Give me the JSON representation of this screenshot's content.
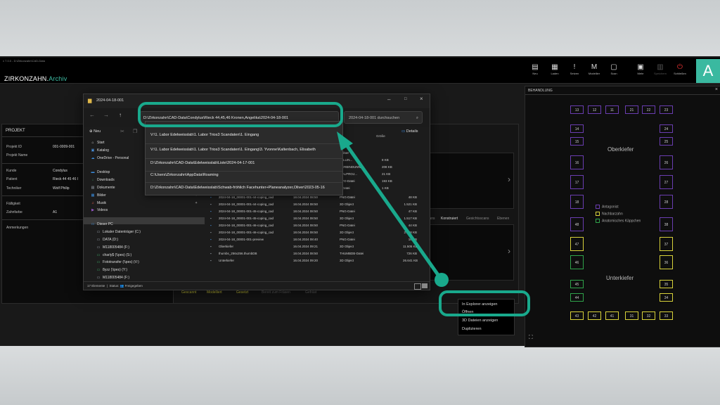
{
  "app": {
    "window_caption": "v 7.0.0 - D:\\Zirkonzahn\\CAD-Data",
    "logo_main": "ZIRKONZAHN.",
    "logo_accent": "Archiv",
    "badge": "A",
    "toolbar": [
      {
        "label": "Neu",
        "icon": "file-icon",
        "glyph": "▤"
      },
      {
        "label": "Laden",
        "icon": "folder-icon",
        "glyph": "▦"
      },
      {
        "label": "Setzen",
        "icon": "exclamation-icon",
        "glyph": "!"
      },
      {
        "label": "Modellier",
        "icon": "m-icon",
        "glyph": "M"
      },
      {
        "label": "Scan",
        "icon": "scan-icon",
        "glyph": "▢"
      },
      {
        "label": "Mehr",
        "icon": "more-icon",
        "glyph": "▣"
      },
      {
        "label": "Speichern",
        "icon": "save-icon",
        "glyph": "▥"
      },
      {
        "label": "Schließen",
        "icon": "close-app-icon",
        "glyph": "⏻"
      }
    ]
  },
  "projekt": {
    "title": "PROJEKT",
    "projekt_id_label": "Projekt ID",
    "projekt_id": "001-0009-001",
    "projekt_name_label": "Projekt Name",
    "kunde_label": "Kunde",
    "kunde": "Condylus",
    "patient_label": "Patient",
    "patient": "Rieck 44 45 46 I",
    "techniker_label": "Techniker",
    "techniker": "Wolf Philip",
    "faelligkeit_label": "Fälligkeit",
    "zahnfarbe_label": "Zahnfarbe",
    "zahnfarbe": "A1",
    "anmerkungen_label": "Anmerkungen"
  },
  "scan_tabs": [
    "Konstruiert",
    "Gesichtsscans",
    "Ebenen"
  ],
  "scan_tab_partial": "cans",
  "status_steps": [
    "Gescannt",
    "Modelliert",
    "Gesetzt",
    "Bereit zum Fräsen",
    "Gefräst"
  ],
  "explorer": {
    "tab_title": "2024-04-18-001",
    "address": "D:\\Zirkonzahn\\CAD-Data\\Condylus\\Rieck 44,45,46 Kronen,Angelika\\2024-04-18-001",
    "search_placeholder": "2024-04-18-001 durchsuchen",
    "new_label": "Neu",
    "details_label": "Details",
    "column_size": "Größe",
    "dropdown": [
      "V:\\1. Labor Edelweisslab\\1. Labor Trios3 Scandaten\\1. Eingang",
      "V:\\1. Labor Edelweisslab\\1. Labor Trios3 Scandaten\\1. Eingang\\3. Yvonne\\Kaltenbach, Elisabeth",
      "D:\\Zirkonzahn\\CAD-Data\\Edelweisslab\\Liste\\2024-04-17-001",
      "C:\\Users\\Zirkonzahn\\AppData\\Roaming",
      "D:\\Zirkonzahn\\CAD-Data\\Edelweisslab\\Schwab-fröhlich Facehunter+Planeanalyzer,Oliver\\2023-05-16"
    ],
    "sidebar": [
      {
        "label": "Start",
        "icon": "home-icon",
        "glyph": "⌂",
        "color": "#d9d9d9"
      },
      {
        "label": "Katalog",
        "icon": "gallery-icon",
        "glyph": "▣",
        "color": "#4a8fd8"
      },
      {
        "label": "OneDrive - Personal",
        "icon": "cloud-icon",
        "glyph": "☁",
        "color": "#3b8ee0"
      },
      {
        "label": "Desktop",
        "icon": "desktop-icon",
        "glyph": "▬",
        "color": "#3b8ee0"
      },
      {
        "label": "Downloads",
        "icon": "download-icon",
        "glyph": "↓",
        "color": "#3fae6a"
      },
      {
        "label": "Dokumente",
        "icon": "document-icon",
        "glyph": "▤",
        "color": "#9aa3ad"
      },
      {
        "label": "Bilder",
        "icon": "picture-icon",
        "glyph": "▦",
        "color": "#3b8ee0"
      },
      {
        "label": "Musik",
        "icon": "music-icon",
        "glyph": "♫",
        "color": "#e05a4a"
      },
      {
        "label": "Videos",
        "icon": "video-icon",
        "glyph": "▶",
        "color": "#9b59d0"
      },
      {
        "label": "Dieser PC",
        "icon": "pc-icon",
        "glyph": "▭",
        "color": "#3b8ee0"
      },
      {
        "label": "Lokaler Datenträger (C:)",
        "icon": "drive-icon",
        "glyph": "▭",
        "color": "#9aa3ad"
      },
      {
        "label": "DATA (D:)",
        "icon": "drive-icon",
        "glyph": "▭",
        "color": "#9aa3ad"
      },
      {
        "label": "M118005484 (F:)",
        "icon": "drive-icon",
        "glyph": "▭",
        "color": "#9aa3ad"
      },
      {
        "label": "charly$ (\\\\pes) (S:)",
        "icon": "network-drive-icon",
        "glyph": "▭",
        "color": "#3fae6a"
      },
      {
        "label": "Fototransfer (\\\\pes) (V:)",
        "icon": "network-drive-icon",
        "glyph": "▭",
        "color": "#3fae6a"
      },
      {
        "label": "8yzz (\\\\pes) (Y:)",
        "icon": "network-drive-icon",
        "glyph": "▭",
        "color": "#3fae6a"
      },
      {
        "label": "M118005484 (F:)",
        "icon": "drive-icon",
        "glyph": "▭",
        "color": "#9aa3ad"
      }
    ],
    "partial_rows": [
      {
        "type": "ordner",
        "size": ""
      },
      {
        "type": "MILLIN...",
        "size": "8 KB"
      },
      {
        "type": "VERBINDUNN...",
        "size": "208 KB"
      },
      {
        "type": "ITALPROJ...",
        "size": "21 KB"
      },
      {
        "type": "NFO-Datei",
        "size": "193 KB"
      },
      {
        "type": "T-Datei",
        "size": "1 KB"
      }
    ],
    "files": [
      {
        "name": "2024-04-18_00001-001-44-coping_cad",
        "date": "18.04.2024 08:50",
        "type": "PNG-Datei",
        "size": "48 KB"
      },
      {
        "name": "2024-04-18_00001-001-44-coping_cad",
        "date": "18.04.2024 08:50",
        "type": "3D Object",
        "size": "1.521 KB"
      },
      {
        "name": "2024-04-18_00001-001-45-coping_cad",
        "date": "18.04.2024 08:50",
        "type": "PNG-Datei",
        "size": "47 KB"
      },
      {
        "name": "2024-04-18_00001-001-45-coping_cad",
        "date": "18.04.2024 08:50",
        "type": "3D Object",
        "size": "1.517 KB"
      },
      {
        "name": "2024-04-18_00001-001-46-coping_cad",
        "date": "18.04.2024 08:50",
        "type": "PNG-Datei",
        "size": "44 KB"
      },
      {
        "name": "2024-04-18_00001-001-46-coping_cad",
        "date": "18.04.2024 08:50",
        "type": "3D Object",
        "size": "2.638 KB"
      },
      {
        "name": "2024-04-18_00001-001-preview",
        "date": "18.04.2024 08:40",
        "type": "PNG-Datei",
        "size": "16 KB"
      },
      {
        "name": "Oberkiefer",
        "date": "16.04.2024 09:21",
        "type": "3D Object",
        "size": "11.505 KB"
      },
      {
        "name": "thumbs_256x256.thumbDB",
        "date": "18.04.2024 08:50",
        "type": "THUMBDB-Datei",
        "size": "726 KB"
      },
      {
        "name": "Unterkiefer",
        "date": "16.04.2024 09:20",
        "type": "3D Object",
        "size": "26.641 KB"
      }
    ],
    "status_count": "17 Elemente",
    "status_label": "Status:",
    "status_shared": "Freigegeben"
  },
  "behandlung": {
    "title": "BEHANDLUNG",
    "oberkiefer": "Oberkiefer",
    "unterkiefer": "Unterkiefer",
    "legend": [
      {
        "label": "Antagonist",
        "color": "#6a3db0"
      },
      {
        "label": "Nachbarzahn",
        "color": "#d8d23a"
      },
      {
        "label": "Anatomisches Käppchen",
        "color": "#2fa34a"
      }
    ],
    "upper_row": [
      "13",
      "12",
      "11",
      "21",
      "22",
      "23"
    ],
    "left_upper_col": [
      "14",
      "15",
      "16",
      "17",
      "18"
    ],
    "right_upper_col": [
      "24",
      "25",
      "26",
      "27",
      "28"
    ],
    "left_lower_col": [
      "48",
      "47",
      "46",
      "45",
      "44"
    ],
    "right_lower_col": [
      "38",
      "37",
      "36",
      "35",
      "34"
    ],
    "lower_row": [
      "43",
      "42",
      "41",
      "31",
      "32",
      "33"
    ]
  },
  "context_menu": [
    "In Explorer anzeigen",
    "Öffnen",
    "3D Dateien anzeigen",
    "Duplizieren"
  ]
}
